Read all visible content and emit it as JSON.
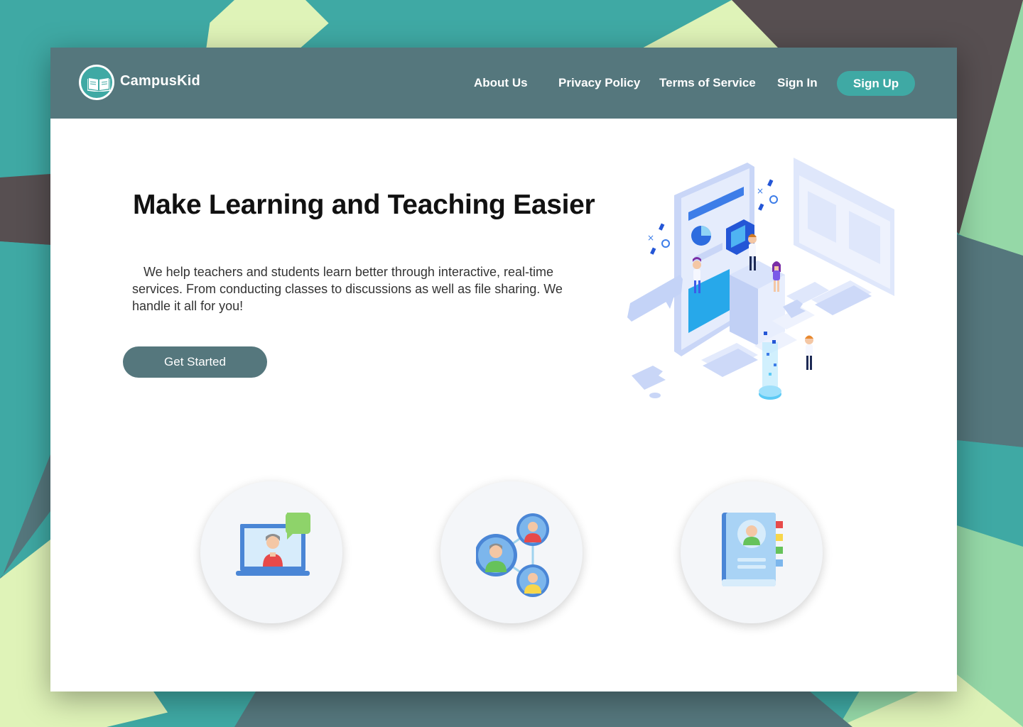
{
  "brand": {
    "name": "CampusKid",
    "logo_icon": "open-book-icon"
  },
  "nav": {
    "about": "About Us",
    "privacy": "Privacy Policy",
    "terms": "Terms of Service",
    "signin": "Sign In",
    "signup": "Sign Up"
  },
  "hero": {
    "title": "Make Learning and Teaching Easier",
    "description": "We help teachers and students learn better through interactive, real-time services. From conducting classes to discussions as well as file sharing. We handle it all for you!",
    "cta": "Get Started",
    "illustration": "isometric-phone-classroom-illustration"
  },
  "features": [
    {
      "icon": "video-lesson-icon"
    },
    {
      "icon": "user-network-icon"
    },
    {
      "icon": "address-book-icon"
    }
  ],
  "colors": {
    "header": "#55777d",
    "accent": "#3fa9a4",
    "cta": "#55777d",
    "background_teal": "#3fa9a4",
    "background_green": "#95d8a7",
    "background_lime": "#dff3b8",
    "background_dark": "#574f51"
  }
}
